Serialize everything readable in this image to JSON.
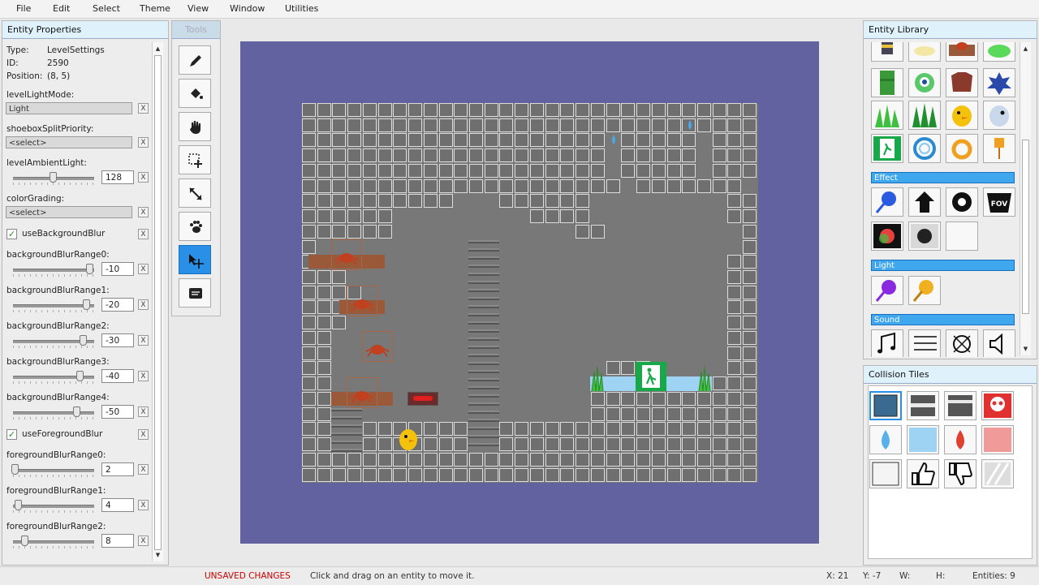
{
  "menu": [
    "File",
    "Edit",
    "Select",
    "Theme",
    "View",
    "Window",
    "Utilities"
  ],
  "properties_panel": {
    "title": "Entity Properties",
    "type_label": "Type:",
    "type_value": "LevelSettings",
    "id_label": "ID:",
    "id_value": "2590",
    "position_label": "Position:",
    "position_value": "(8, 5)",
    "level_light_mode_label": "levelLightMode:",
    "level_light_mode_value": "Light",
    "shoebox_label": "shoeboxSplitPriority:",
    "shoebox_value": "<select>",
    "ambient_label": "levelAmbientLight:",
    "ambient_value": "128",
    "color_grading_label": "colorGrading:",
    "color_grading_value": "<select>",
    "use_bg_blur_label": "useBackgroundBlur",
    "bg_blur": [
      {
        "label": "backgroundBlurRange0:",
        "value": "-10"
      },
      {
        "label": "backgroundBlurRange1:",
        "value": "-20"
      },
      {
        "label": "backgroundBlurRange2:",
        "value": "-30"
      },
      {
        "label": "backgroundBlurRange3:",
        "value": "-40"
      },
      {
        "label": "backgroundBlurRange4:",
        "value": "-50"
      }
    ],
    "use_fg_blur_label": "useForegroundBlur",
    "fg_blur": [
      {
        "label": "foregroundBlurRange0:",
        "value": "2"
      },
      {
        "label": "foregroundBlurRange1:",
        "value": "4"
      },
      {
        "label": "foregroundBlurRange2:",
        "value": "8"
      }
    ],
    "clear_glyph": "X",
    "check_glyph": "✓"
  },
  "tools_panel": {
    "title": "Tools"
  },
  "library_panel": {
    "title": "Entity Library",
    "categories": {
      "effect": "Effect",
      "light": "Light",
      "sound": "Sound"
    }
  },
  "collision_panel": {
    "title": "Collision Tiles"
  },
  "status": {
    "unsaved": "UNSAVED CHANGES",
    "hint": "Click and drag on an entity to move it.",
    "x": "X:  21",
    "y": "Y:  -7",
    "w": "W:",
    "h": "H:",
    "entities": "Entities:  9"
  },
  "colors": {
    "accent": "#2a8fe6",
    "canvas": "#6262a1",
    "unsaved": "#cc0000"
  }
}
